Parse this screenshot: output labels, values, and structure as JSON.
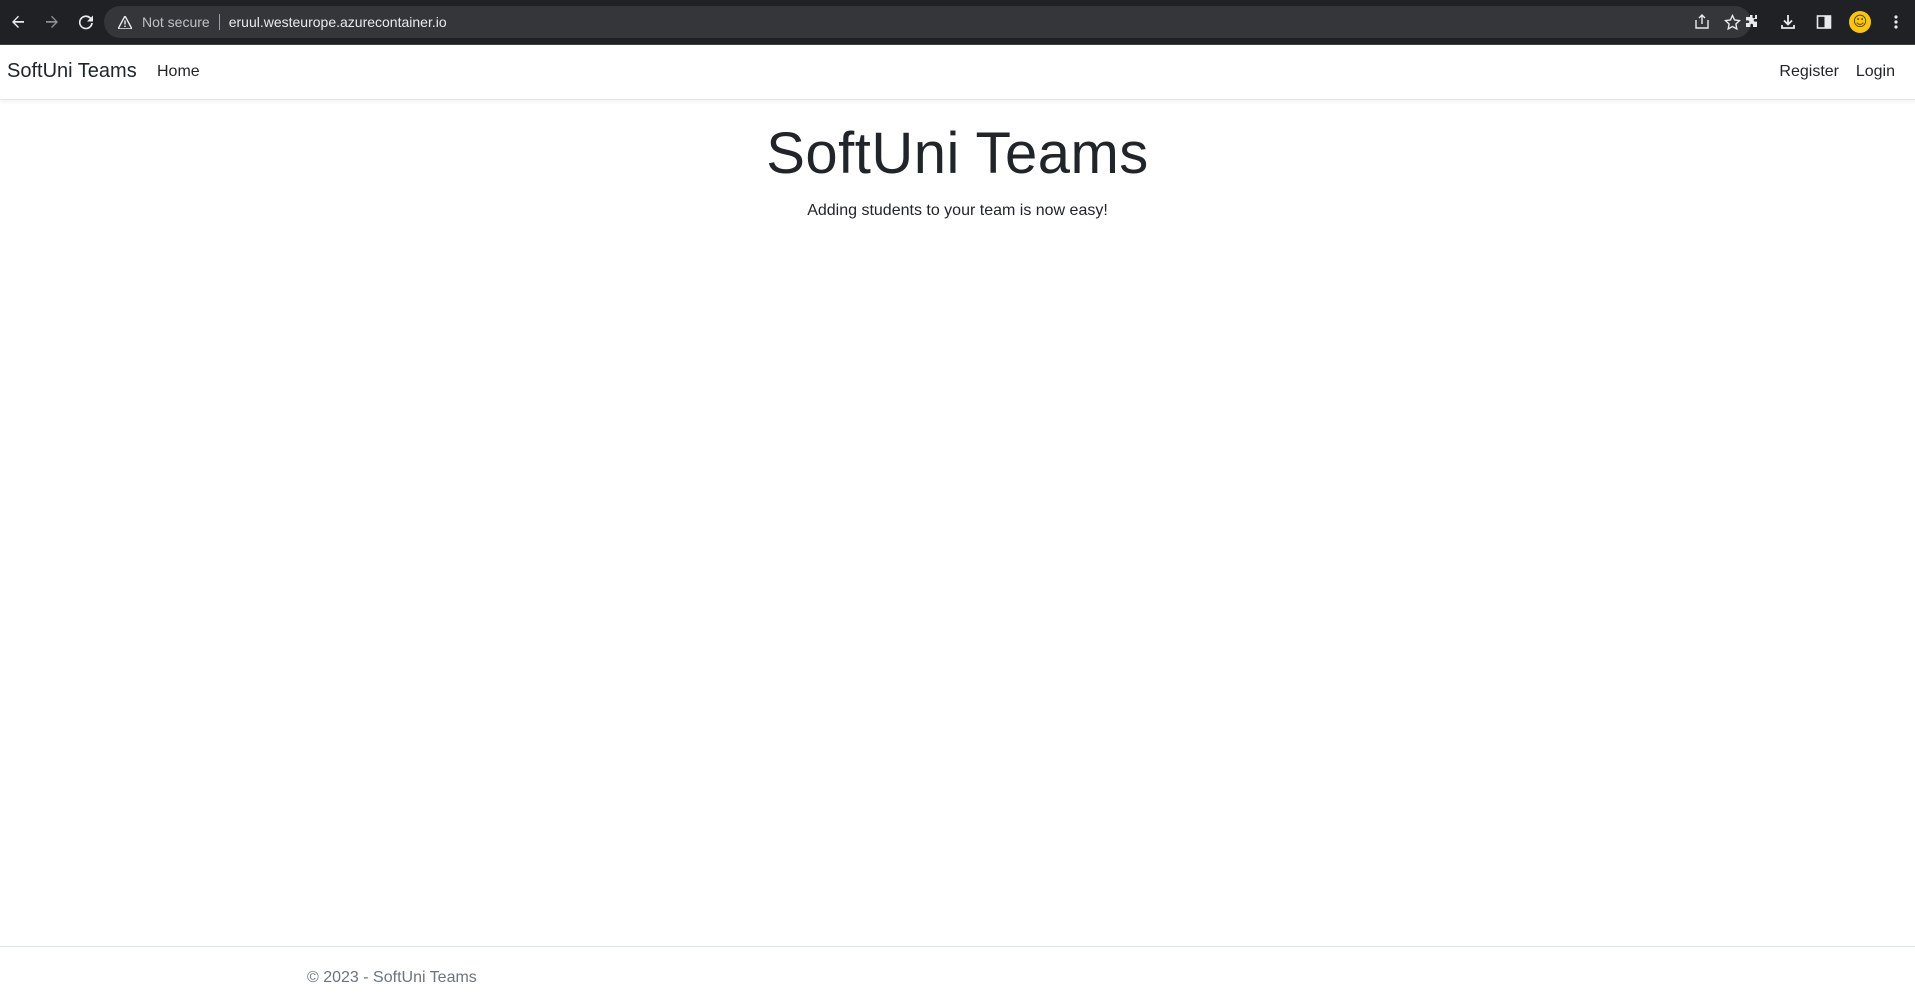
{
  "browser": {
    "security_label": "Not secure",
    "url": "eruul.westeurope.azurecontainer.io",
    "icons": {
      "back": "arrow-left-icon",
      "forward": "arrow-right-icon",
      "reload": "reload-icon",
      "warning": "warning-triangle-icon",
      "share": "share-icon",
      "bookmark": "star-icon",
      "extensions": "puzzle-icon",
      "downloads": "download-icon",
      "side_panel": "side-panel-icon",
      "profile": "profile-avatar-icon",
      "menu": "kebab-menu-icon"
    }
  },
  "navbar": {
    "brand": "SoftUni Teams",
    "links": {
      "home": "Home",
      "register": "Register",
      "login": "Login"
    }
  },
  "main": {
    "title": "SoftUni Teams",
    "subtitle": "Adding students to your team is now easy!"
  },
  "footer": {
    "text": "© 2023 - SoftUni Teams"
  },
  "colors": {
    "chrome_bg": "#202124",
    "omnibox_bg": "#35363a",
    "text_dark": "#212529",
    "footer_text": "#6c757d",
    "avatar": "#f9c513"
  }
}
